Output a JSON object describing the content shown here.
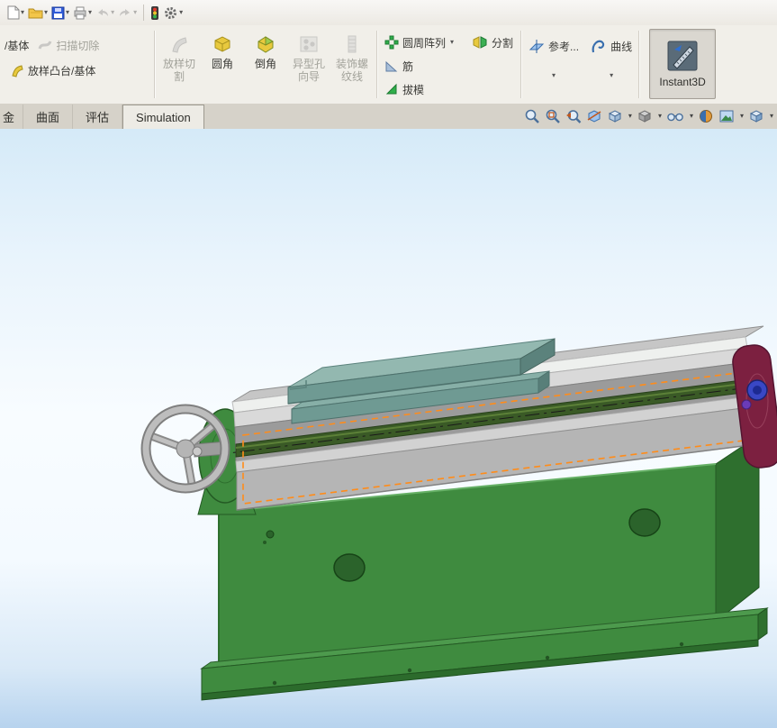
{
  "quick_access": {
    "icons": [
      {
        "name": "new-document",
        "caret": true
      },
      {
        "name": "open",
        "caret": true
      },
      {
        "name": "save",
        "caret": true
      },
      {
        "name": "print",
        "caret": true
      },
      {
        "name": "undo",
        "caret": true,
        "disabled": true
      },
      {
        "name": "redo",
        "caret": true,
        "disabled": true
      },
      {
        "name": "rebuild-traffic-light",
        "caret": false
      },
      {
        "name": "options-gear",
        "caret": true
      }
    ]
  },
  "ribbon_items": [
    {
      "id": "boss-base-partial",
      "label": "/基体",
      "disabled": false
    },
    {
      "id": "sweep-cut",
      "label": "扫描切除",
      "disabled": true
    },
    {
      "id": "loft-boss-base",
      "label": "放样凸台/基体",
      "disabled": false
    },
    {
      "id": "loft-cut",
      "label": "放样切割",
      "disabled": true
    },
    {
      "id": "fillet",
      "label": "圆角",
      "disabled": false
    },
    {
      "id": "chamfer",
      "label": "倒角",
      "disabled": false
    },
    {
      "id": "hole-wizard",
      "label": "异型孔向导",
      "disabled": true
    },
    {
      "id": "cosmetic-thread",
      "label": "装饰螺纹线",
      "disabled": true
    },
    {
      "id": "circular-pattern",
      "label": "圆周阵列",
      "disabled": false
    },
    {
      "id": "rib",
      "label": "筋",
      "disabled": false
    },
    {
      "id": "draft",
      "label": "拔模",
      "disabled": false
    },
    {
      "id": "split",
      "label": "分割",
      "disabled": false
    },
    {
      "id": "reference-geometry",
      "label": "参考...",
      "disabled": false
    },
    {
      "id": "curves",
      "label": "曲线",
      "disabled": false
    },
    {
      "id": "instant3d",
      "label": "Instant3D",
      "disabled": false,
      "active": true
    }
  ],
  "tabs": [
    {
      "label": "金",
      "cut": true
    },
    {
      "label": "曲面"
    },
    {
      "label": "评估"
    },
    {
      "label": "Simulation",
      "boxed": true
    }
  ],
  "headsup_icons": [
    {
      "name": "zoom-to-fit",
      "caret": false
    },
    {
      "name": "zoom-to-area",
      "caret": false
    },
    {
      "name": "previous-view",
      "caret": false
    },
    {
      "name": "section-view",
      "caret": false
    },
    {
      "name": "view-orientation",
      "caret": true
    },
    {
      "name": "display-style",
      "caret": true
    },
    {
      "name": "hide-show-items",
      "caret": true
    },
    {
      "name": "edit-appearance",
      "caret": false
    },
    {
      "name": "apply-scene",
      "caret": true
    },
    {
      "name": "view-settings",
      "caret": true
    }
  ],
  "viewport": {
    "gradient_top": "#d5eaf8",
    "gradient_middle": "#f8fcff",
    "gradient_bottom": "#b7d3ee"
  },
  "model": {
    "subject": "green linear-slide machine assembly with handwheel, teal slide table, lead screw and maroon end plate",
    "colors": {
      "base_green": "#3f8b3f",
      "base_green_dark": "#2e6f2e",
      "rail_silver": "#d9d9d9",
      "slide_gray": "#b5b5b5",
      "channel_gray": "#9b9b9b",
      "table_teal": "#93b8b0",
      "table_teal_dark": "#6f9a93",
      "lead_screw_green": "#3a5a26",
      "end_plate_maroon": "#7c2040",
      "bearing_blue": "#3947c4",
      "handwheel_gray": "#b8b8b8",
      "selection_outline_orange": "#ff8c1a"
    }
  }
}
